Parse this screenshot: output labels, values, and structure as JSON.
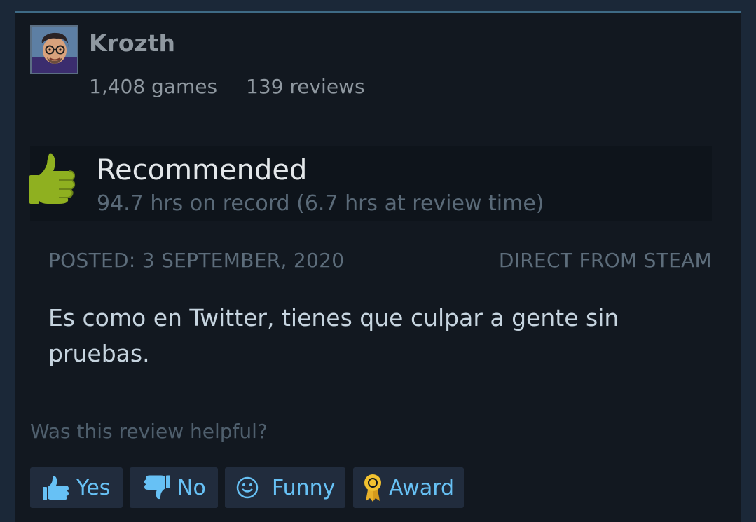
{
  "author": {
    "name": "Krozth",
    "games": "1,408 games",
    "reviews": "139 reviews",
    "avatar_icon": "cartoon-avatar-icon"
  },
  "verdict": {
    "title": "Recommended",
    "hours": "94.7 hrs on record (6.7 hrs at review time)",
    "icon": "thumbs-up-icon",
    "color": "#a4d007"
  },
  "meta": {
    "posted": "POSTED: 3 SEPTEMBER, 2020",
    "source": "DIRECT FROM STEAM"
  },
  "review": {
    "text": "Es como en Twitter, tienes que culpar a gente sin pruebas."
  },
  "feedback": {
    "prompt": "Was this review helpful?",
    "yes_label": "Yes",
    "no_label": "No",
    "funny_label": "Funny",
    "award_label": "Award",
    "button_color": "#67c1f5"
  },
  "colors": {
    "background": "#121820",
    "accent_rule": "#3e6a85",
    "award_gold": "#e8b12a"
  }
}
